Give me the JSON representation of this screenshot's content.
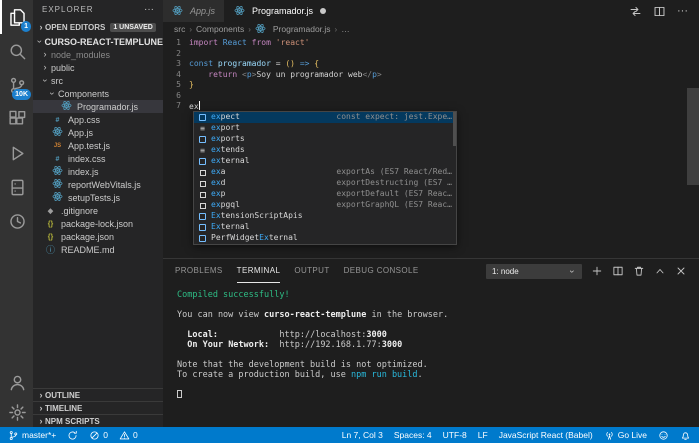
{
  "activity_bar": {
    "top": [
      {
        "icon": "files-icon",
        "badge": "1",
        "active": true
      },
      {
        "icon": "search-icon"
      },
      {
        "icon": "source-control-icon",
        "badge": "10K"
      },
      {
        "icon": "extensions-icon"
      },
      {
        "icon": "run-debug-icon"
      },
      {
        "icon": "remote-explorer-icon"
      },
      {
        "icon": "live-share-icon"
      }
    ],
    "bottom": [
      {
        "icon": "account-icon"
      },
      {
        "icon": "settings-icon"
      }
    ]
  },
  "sidebar": {
    "title": "EXPLORER",
    "more": "···",
    "open_editors": {
      "label": "OPEN EDITORS",
      "badge": "1 UNSAVED"
    },
    "tree": [
      {
        "label": "CURSO-REACT-TEMPLUNE",
        "chevron": "down",
        "indent": 0,
        "bold": true
      },
      {
        "label": "node_modules",
        "chevron": "right",
        "indent": 1,
        "dim": true
      },
      {
        "label": "public",
        "chevron": "right",
        "indent": 1
      },
      {
        "label": "src",
        "chevron": "down",
        "indent": 1
      },
      {
        "label": "Components",
        "chevron": "down",
        "indent": 2
      },
      {
        "label": "Programador.js",
        "icon": "react-icon",
        "indent": 3,
        "selected": true
      },
      {
        "label": "App.css",
        "icon": "css-icon",
        "indent": 2
      },
      {
        "label": "App.js",
        "icon": "react-icon",
        "indent": 2
      },
      {
        "label": "App.test.js",
        "icon": "js-test-icon",
        "indent": 2
      },
      {
        "label": "index.css",
        "icon": "css-icon",
        "indent": 2
      },
      {
        "label": "index.js",
        "icon": "react-icon",
        "indent": 2
      },
      {
        "label": "reportWebVitals.js",
        "icon": "react-icon",
        "indent": 2
      },
      {
        "label": "setupTests.js",
        "icon": "react-icon",
        "indent": 2
      },
      {
        "label": ".gitignore",
        "icon": "git-icon",
        "indent": 1
      },
      {
        "label": "package-lock.json",
        "icon": "json-icon",
        "indent": 1
      },
      {
        "label": "package.json",
        "icon": "json-icon",
        "indent": 1
      },
      {
        "label": "README.md",
        "icon": "info-icon",
        "indent": 1
      }
    ],
    "sections": [
      "OUTLINE",
      "TIMELINE",
      "NPM SCRIPTS"
    ]
  },
  "editor": {
    "tabs": [
      {
        "label": "App.js",
        "icon": "react-icon",
        "preview": true
      },
      {
        "label": "Programador.js",
        "icon": "react-icon",
        "active": true,
        "dirty": true
      }
    ],
    "actions": [
      "open-changes-icon",
      "split-editor-icon",
      "more-actions-icon"
    ],
    "breadcrumb": [
      {
        "label": "src"
      },
      {
        "label": "Components"
      },
      {
        "label": "Programador.js",
        "icon": "react-icon"
      },
      {
        "label": "…"
      }
    ],
    "code_lines": [
      {
        "n": 1,
        "tokens": [
          {
            "t": "import",
            "c": "kw2"
          },
          {
            "t": " "
          },
          {
            "t": "React",
            "c": "kw"
          },
          {
            "t": " "
          },
          {
            "t": "from",
            "c": "kw2"
          },
          {
            "t": " "
          },
          {
            "t": "'react'",
            "c": "str"
          }
        ]
      },
      {
        "n": 2,
        "tokens": []
      },
      {
        "n": 3,
        "tokens": [
          {
            "t": "const",
            "c": "kw"
          },
          {
            "t": " "
          },
          {
            "t": "programador",
            "c": "var"
          },
          {
            "t": " = "
          },
          {
            "t": "()",
            "c": "gold"
          },
          {
            "t": " "
          },
          {
            "t": "=>",
            "c": "kw"
          },
          {
            "t": " "
          },
          {
            "t": "{",
            "c": "gold"
          }
        ]
      },
      {
        "n": 4,
        "tokens": [
          {
            "t": "    "
          },
          {
            "t": "return",
            "c": "kw2"
          },
          {
            "t": " "
          },
          {
            "t": "<",
            "c": "tagb"
          },
          {
            "t": "p",
            "c": "tag"
          },
          {
            "t": ">",
            "c": "tagb"
          },
          {
            "t": "Soy un programador web"
          },
          {
            "t": "</",
            "c": "tagb"
          },
          {
            "t": "p",
            "c": "tag"
          },
          {
            "t": ">",
            "c": "tagb"
          }
        ]
      },
      {
        "n": 5,
        "tokens": [
          {
            "t": "}",
            "c": "gold"
          }
        ]
      },
      {
        "n": 6,
        "tokens": []
      },
      {
        "n": 7,
        "tokens": [
          {
            "t": "ex"
          },
          {
            "cursor": true
          }
        ]
      }
    ],
    "suggest": {
      "items": [
        {
          "kind": "variable",
          "parts": [
            {
              "t": "ex",
              "m": true
            },
            {
              "t": "pect"
            }
          ],
          "detail": "const expect: jest.Expe…",
          "selected": true
        },
        {
          "kind": "keyword",
          "parts": [
            {
              "t": "ex",
              "m": true
            },
            {
              "t": "port"
            }
          ]
        },
        {
          "kind": "variable",
          "parts": [
            {
              "t": "ex",
              "m": true
            },
            {
              "t": "ports"
            }
          ]
        },
        {
          "kind": "keyword",
          "parts": [
            {
              "t": "ex",
              "m": true
            },
            {
              "t": "tends"
            }
          ]
        },
        {
          "kind": "variable",
          "parts": [
            {
              "t": "ex",
              "m": true
            },
            {
              "t": "ternal"
            }
          ]
        },
        {
          "kind": "snippet",
          "parts": [
            {
              "t": "ex",
              "m": true
            },
            {
              "t": "a"
            }
          ],
          "detail": "exportAs (ES7 React/Red…"
        },
        {
          "kind": "snippet",
          "parts": [
            {
              "t": "ex",
              "m": true
            },
            {
              "t": "d"
            }
          ],
          "detail": "exportDestructing (ES7 …"
        },
        {
          "kind": "snippet",
          "parts": [
            {
              "t": "ex",
              "m": true
            },
            {
              "t": "p"
            }
          ],
          "detail": "exportDefault (ES7 Reac…"
        },
        {
          "kind": "snippet",
          "parts": [
            {
              "t": "ex",
              "m": true
            },
            {
              "t": "pgql"
            }
          ],
          "detail": "exportGraphQL (ES7 Reac…"
        },
        {
          "kind": "variable",
          "parts": [
            {
              "t": "Ex",
              "m": true
            },
            {
              "t": "tensionScriptApis"
            }
          ]
        },
        {
          "kind": "variable",
          "parts": [
            {
              "t": "Ex",
              "m": true
            },
            {
              "t": "ternal"
            }
          ]
        },
        {
          "kind": "variable",
          "parts": [
            {
              "t": "PerfWidget"
            },
            {
              "t": "Ex",
              "m": true
            },
            {
              "t": "ternal"
            }
          ]
        }
      ]
    }
  },
  "panel": {
    "tabs": [
      {
        "label": "PROBLEMS"
      },
      {
        "label": "TERMINAL",
        "active": true
      },
      {
        "label": "OUTPUT"
      },
      {
        "label": "DEBUG CONSOLE"
      }
    ],
    "terminal_select": "1: node",
    "actions": [
      "new-terminal-icon",
      "split-terminal-icon",
      "kill-terminal-icon",
      "maximize-panel-icon",
      "close-panel-icon"
    ],
    "terminal": {
      "lines": [
        [
          {
            "t": "Compiled successfully!",
            "c": "green"
          }
        ],
        [],
        [
          {
            "t": "You can now view "
          },
          {
            "t": "curso-react-templune",
            "b": true
          },
          {
            "t": " in the browser."
          }
        ],
        [],
        [
          {
            "t": "  "
          },
          {
            "t": "Local:",
            "b": true
          },
          {
            "t": "            http://localhost:"
          },
          {
            "t": "3000",
            "b": true
          }
        ],
        [
          {
            "t": "  "
          },
          {
            "t": "On Your Network:",
            "b": true
          },
          {
            "t": "  http://192.168.1.77:"
          },
          {
            "t": "3000",
            "b": true
          }
        ],
        [],
        [
          {
            "t": "Note that the development build is not optimized."
          }
        ],
        [
          {
            "t": "To create a production build, use "
          },
          {
            "t": "npm run build",
            "c": "cyan"
          },
          {
            "t": "."
          }
        ],
        [],
        [
          {
            "cursor": true
          }
        ]
      ]
    }
  },
  "status_bar": {
    "left": [
      {
        "icon": "branch-icon",
        "label": "master*+"
      },
      {
        "icon": "sync-icon"
      },
      {
        "icon": "error-icon",
        "label": "0"
      },
      {
        "icon": "warning-icon",
        "label": "0"
      }
    ],
    "right": [
      {
        "label": "Ln 7, Col 3"
      },
      {
        "label": "Spaces: 4"
      },
      {
        "label": "UTF-8"
      },
      {
        "label": "LF"
      },
      {
        "label": "JavaScript React (Babel)"
      },
      {
        "icon": "broadcast-icon",
        "label": "Go Live"
      },
      {
        "icon": "feedback-icon"
      },
      {
        "icon": "bell-icon"
      }
    ]
  },
  "colors": {
    "status_bar": "#007acc",
    "badge_blue": "#1c80ce",
    "terminal_green": "#2ebd85",
    "terminal_cyan": "#29b8db",
    "suggest_selected": "#04395e",
    "match_blue": "#3da9f5"
  }
}
